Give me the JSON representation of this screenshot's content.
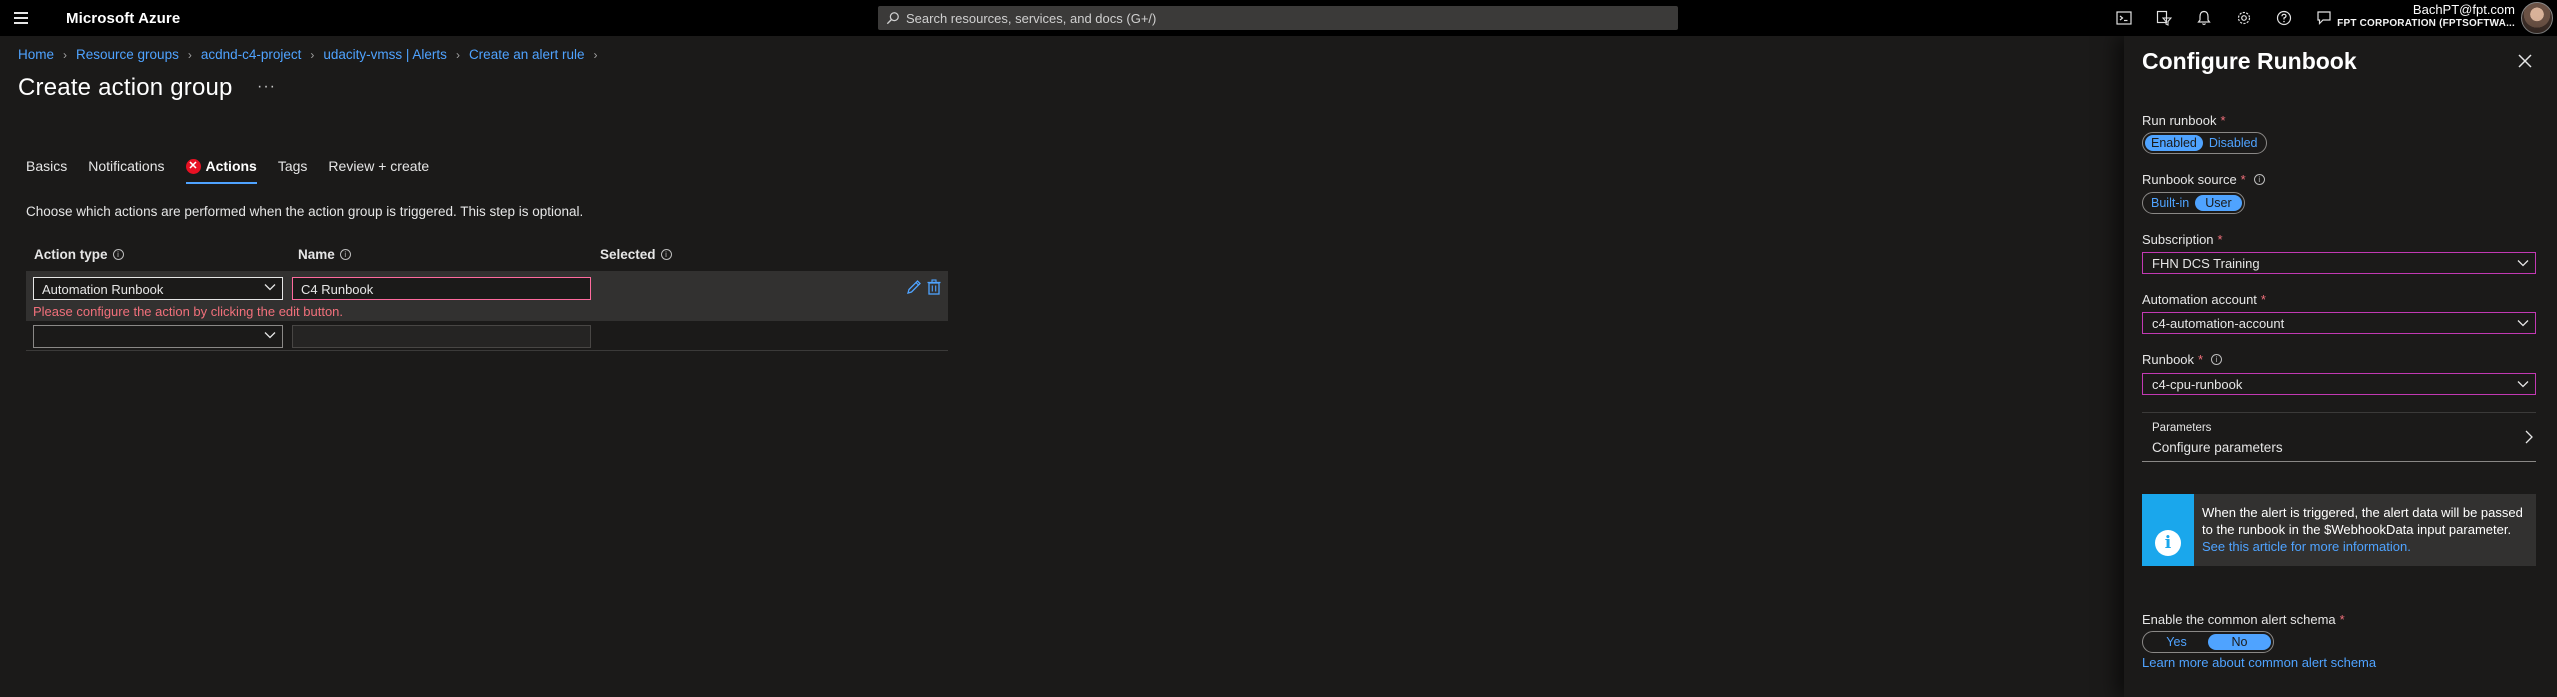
{
  "topbar": {
    "brand": "Microsoft Azure",
    "search_placeholder": "Search resources, services, and docs (G+/)",
    "user": "BachPT@fpt.com",
    "org": "FPT CORPORATION (FPTSOFTWA..."
  },
  "breadcrumb": [
    "Home",
    "Resource groups",
    "acdnd-c4-project",
    "udacity-vmss | Alerts",
    "Create an alert rule"
  ],
  "page": {
    "title": "Create action group",
    "more": "···"
  },
  "tabs": [
    {
      "label": "Basics"
    },
    {
      "label": "Notifications"
    },
    {
      "label": "Actions",
      "error": "✕"
    },
    {
      "label": "Tags"
    },
    {
      "label": "Review + create"
    }
  ],
  "description": "Choose which actions are performed when the action group is triggered. This step is optional.",
  "actions_table": {
    "headers": {
      "action_type": "Action type",
      "name": "Name",
      "selected": "Selected"
    },
    "rows": [
      {
        "action_type": "Automation Runbook",
        "name": "C4 Runbook",
        "error": "Please configure the action by clicking the edit button."
      },
      {
        "action_type": "",
        "name": ""
      }
    ]
  },
  "panel": {
    "title": "Configure Runbook",
    "run_runbook": {
      "label": "Run runbook",
      "options": [
        "Enabled",
        "Disabled"
      ],
      "selected": "Enabled"
    },
    "runbook_source": {
      "label": "Runbook source",
      "options": [
        "Built-in",
        "User"
      ],
      "selected": "User"
    },
    "subscription": {
      "label": "Subscription",
      "value": "FHN DCS Training"
    },
    "automation_account": {
      "label": "Automation account",
      "value": "c4-automation-account"
    },
    "runbook": {
      "label": "Runbook",
      "value": "c4-cpu-runbook"
    },
    "parameters": {
      "title": "Parameters",
      "link": "Configure parameters"
    },
    "info": {
      "text": "When the alert is triggered, the alert data will be passed to the runbook in the $WebhookData input parameter.",
      "link": "See this article for more information."
    },
    "common_schema": {
      "label": "Enable the common alert schema",
      "options": [
        "Yes",
        "No"
      ],
      "selected": "No"
    },
    "learn_more": "Learn more about common alert schema",
    "required_mark": "*"
  }
}
